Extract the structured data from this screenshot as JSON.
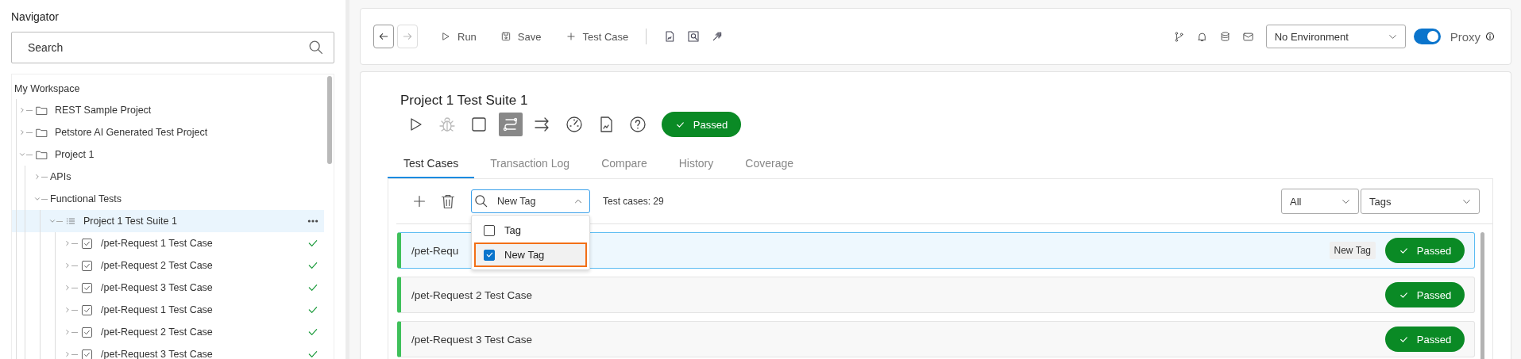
{
  "navigator": {
    "title": "Navigator",
    "search": {
      "placeholder": "Search"
    },
    "tree": {
      "label": "My Workspace",
      "children": [
        {
          "label": "REST Sample Project",
          "kind": "folder",
          "expanded": false,
          "selected": false
        },
        {
          "label": "Petstore AI Generated Test Project",
          "kind": "folder",
          "expanded": false,
          "selected": false
        },
        {
          "label": "Project 1",
          "kind": "folder",
          "expanded": true,
          "selected": false,
          "children": [
            {
              "label": "APIs",
              "expanded": false,
              "selected": false
            },
            {
              "label": "Functional Tests",
              "expanded": true,
              "selected": false,
              "children": [
                {
                  "label": "Project 1 Test Suite 1",
                  "kind": "suite",
                  "expanded": true,
                  "selected": true,
                  "children": [
                    {
                      "label": "/pet-Request 1 Test Case",
                      "kind": "case",
                      "expanded": false,
                      "selected": false,
                      "passed": true
                    },
                    {
                      "label": "/pet-Request 2 Test Case",
                      "kind": "case",
                      "expanded": false,
                      "selected": false,
                      "passed": true
                    },
                    {
                      "label": "/pet-Request 3 Test Case",
                      "kind": "case",
                      "expanded": false,
                      "selected": false,
                      "passed": true
                    },
                    {
                      "label": "/pet-Request 1 Test Case",
                      "kind": "case",
                      "expanded": false,
                      "selected": false,
                      "passed": true
                    },
                    {
                      "label": "/pet-Request 2 Test Case",
                      "kind": "case",
                      "expanded": false,
                      "selected": false,
                      "passed": true
                    },
                    {
                      "label": "/pet-Request 3 Test Case",
                      "kind": "case",
                      "expanded": false,
                      "selected": false,
                      "passed": true
                    }
                  ]
                }
              ]
            }
          ]
        }
      ]
    }
  },
  "toolbar": {
    "nav": [
      {
        "kind": "back",
        "disabled": false
      },
      {
        "kind": "forward",
        "disabled": true
      }
    ],
    "actions": [
      {
        "kind": "run",
        "label": "Run"
      },
      {
        "kind": "save",
        "label": "Save"
      },
      {
        "kind": "add",
        "label": "Test Case"
      }
    ],
    "tools": [
      {
        "kind": "report"
      },
      {
        "kind": "inspect"
      },
      {
        "kind": "jira"
      }
    ],
    "status_icons": [
      {
        "kind": "branch"
      },
      {
        "kind": "bell"
      },
      {
        "kind": "database"
      },
      {
        "kind": "mail"
      }
    ],
    "environment": "No Environment",
    "proxy": {
      "label": "Proxy",
      "on": true
    }
  },
  "suite": {
    "title": "Project 1 Test Suite 1",
    "tools": [
      {
        "kind": "run",
        "disabled": false,
        "selected": false
      },
      {
        "kind": "debug",
        "disabled": true,
        "selected": false
      },
      {
        "kind": "stop",
        "disabled": false,
        "selected": false
      },
      {
        "kind": "flow",
        "disabled": false,
        "selected": true
      },
      {
        "kind": "parallel",
        "disabled": false,
        "selected": false
      },
      {
        "kind": "load",
        "disabled": false,
        "selected": false
      },
      {
        "kind": "report",
        "disabled": false,
        "selected": false
      },
      {
        "kind": "help",
        "disabled": false,
        "selected": false
      }
    ],
    "status": {
      "kind": "passed",
      "label": "Passed"
    },
    "tabs": [
      {
        "label": "Test Cases",
        "selected": true
      },
      {
        "label": "Transaction Log",
        "selected": false
      },
      {
        "label": "Compare",
        "selected": false
      },
      {
        "label": "History",
        "selected": false
      },
      {
        "label": "Coverage",
        "selected": false
      }
    ],
    "tag_filter": {
      "value": "New Tag",
      "expanded": true,
      "options": [
        {
          "label": "Tag",
          "checked": false,
          "highlighted": false
        },
        {
          "label": "New Tag",
          "checked": true,
          "highlighted": true
        }
      ]
    },
    "count": "Test cases: 29",
    "scope_select": "All",
    "tags_select": "Tags",
    "test_cases": [
      {
        "name": "/pet-Requ",
        "selected": true,
        "tags": [
          "New Tag"
        ],
        "status": {
          "kind": "passed",
          "label": "Passed"
        }
      },
      {
        "name": "/pet-Request 2 Test Case",
        "selected": false,
        "status": {
          "kind": "passed",
          "label": "Passed"
        }
      },
      {
        "name": "/pet-Request 3 Test Case",
        "selected": false,
        "status": {
          "kind": "passed",
          "label": "Passed"
        }
      }
    ]
  }
}
